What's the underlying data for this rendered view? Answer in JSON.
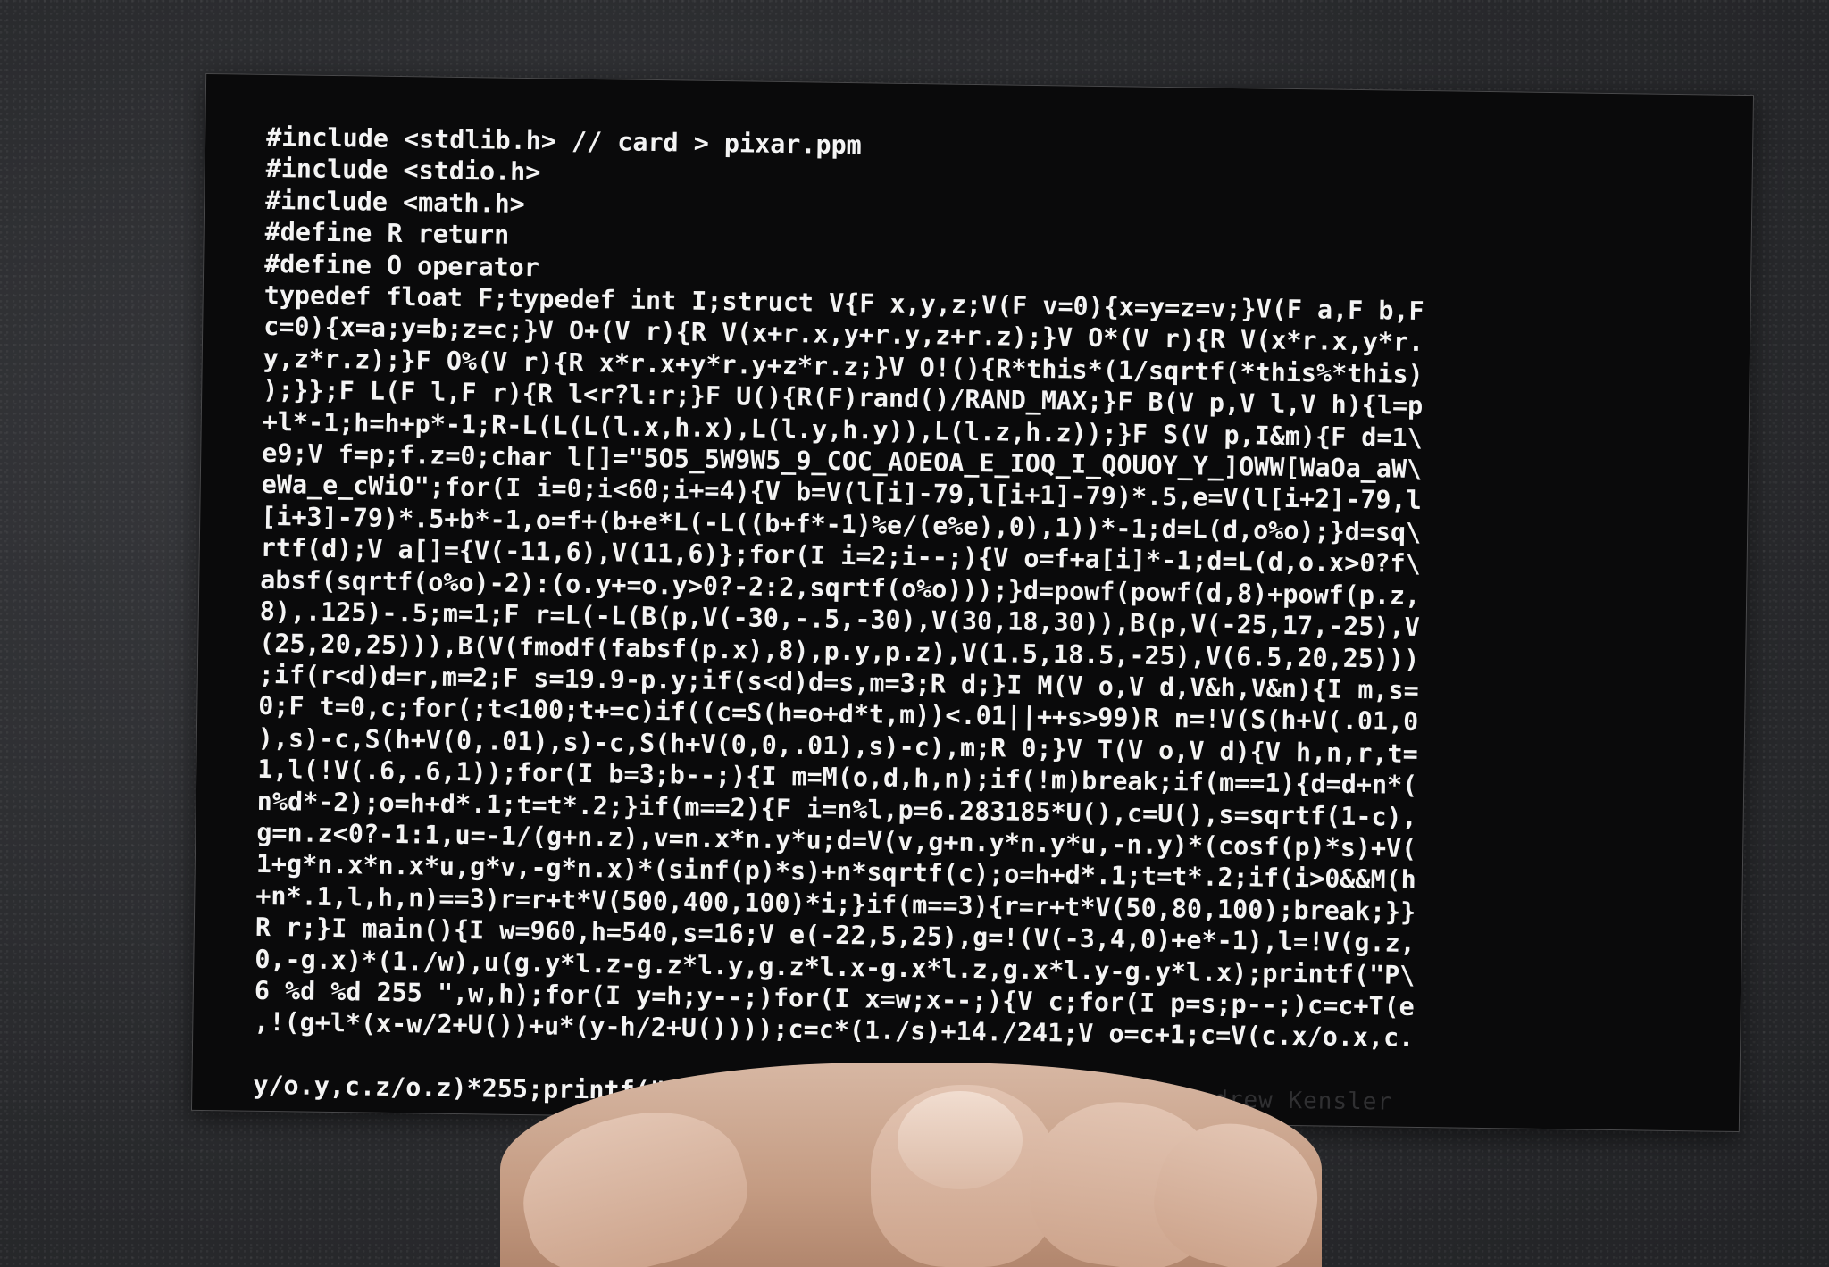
{
  "card": {
    "code_lines": [
      "#include <stdlib.h> // card > pixar.ppm",
      "#include <stdio.h>",
      "#include <math.h>",
      "#define R return",
      "#define O operator",
      "typedef float F;typedef int I;struct V{F x,y,z;V(F v=0){x=y=z=v;}V(F a,F b,F",
      "c=0){x=a;y=b;z=c;}V O+(V r){R V(x+r.x,y+r.y,z+r.z);}V O*(V r){R V(x*r.x,y*r.",
      "y,z*r.z);}F O%(V r){R x*r.x+y*r.y+z*r.z;}V O!(){R*this*(1/sqrtf(*this%*this)",
      ");}};F L(F l,F r){R l<r?l:r;}F U(){R(F)rand()/RAND_MAX;}F B(V p,V l,V h){l=p",
      "+l*-1;h=h+p*-1;R-L(L(L(l.x,h.x),L(l.y,h.y)),L(l.z,h.z));}F S(V p,I&m){F d=1\\",
      "e9;V f=p;f.z=0;char l[]=\"5O5_5W9W5_9_COC_AOEOA_E_IOQ_I_QOUOY_Y_]OWW[WaOa_aW\\",
      "eWa_e_cWiO\";for(I i=0;i<60;i+=4){V b=V(l[i]-79,l[i+1]-79)*.5,e=V(l[i+2]-79,l",
      "[i+3]-79)*.5+b*-1,o=f+(b+e*L(-L((b+f*-1)%e/(e%e),0),1))*-1;d=L(d,o%o);}d=sq\\",
      "rtf(d);V a[]={V(-11,6),V(11,6)};for(I i=2;i--;){V o=f+a[i]*-1;d=L(d,o.x>0?f\\",
      "absf(sqrtf(o%o)-2):(o.y+=o.y>0?-2:2,sqrtf(o%o)));}d=powf(powf(d,8)+powf(p.z,",
      "8),.125)-.5;m=1;F r=L(-L(B(p,V(-30,-.5,-30),V(30,18,30)),B(p,V(-25,17,-25),V",
      "(25,20,25))),B(V(fmodf(fabsf(p.x),8),p.y,p.z),V(1.5,18.5,-25),V(6.5,20,25)))",
      ";if(r<d)d=r,m=2;F s=19.9-p.y;if(s<d)d=s,m=3;R d;}I M(V o,V d,V&h,V&n){I m,s=",
      "0;F t=0,c;for(;t<100;t+=c)if((c=S(h=o+d*t,m))<.01||++s>99)R n=!V(S(h+V(.01,0",
      "),s)-c,S(h+V(0,.01),s)-c,S(h+V(0,0,.01),s)-c),m;R 0;}V T(V o,V d){V h,n,r,t=",
      "1,l(!V(.6,.6,1));for(I b=3;b--;){I m=M(o,d,h,n);if(!m)break;if(m==1){d=d+n*(",
      "n%d*-2);o=h+d*.1;t=t*.2;}if(m==2){F i=n%l,p=6.283185*U(),c=U(),s=sqrtf(1-c),",
      "g=n.z<0?-1:1,u=-1/(g+n.z),v=n.x*n.y*u;d=V(v,g+n.y*n.y*u,-n.y)*(cosf(p)*s)+V(",
      "1+g*n.x*n.x*u,g*v,-g*n.x)*(sinf(p)*s)+n*sqrtf(c);o=h+d*.1;t=t*.2;if(i>0&&M(h",
      "+n*.1,l,h,n)==3)r=r+t*V(500,400,100)*i;}if(m==3){r=r+t*V(50,80,100);break;}}",
      "R r;}I main(){I w=960,h=540,s=16;V e(-22,5,25),g=!(V(-3,4,0)+e*-1),l=!V(g.z,",
      "0,-g.x)*(1./w),u(g.y*l.z-g.z*l.y,g.z*l.x-g.x*l.z,g.x*l.y-g.y*l.x);printf(\"P\\",
      "6 %d %d 255 \",w,h);for(I y=h;y--;)for(I x=w;x--;){V c;for(I p=s;p--;)c=c+T(e",
      ",!(g+l*(x-w/2+U())+u*(y-h/2+U())));c=c*(1./s)+14./241;V o=c+1;c=V(c.x/o.x,c."
    ],
    "last_line": "y/o.y,c.z/o.z)*255;printf(\"%c%c%c\",(I)c.x,(I)c.y,(I)c.z);}}//",
    "signature": "Andrew Kensler"
  }
}
